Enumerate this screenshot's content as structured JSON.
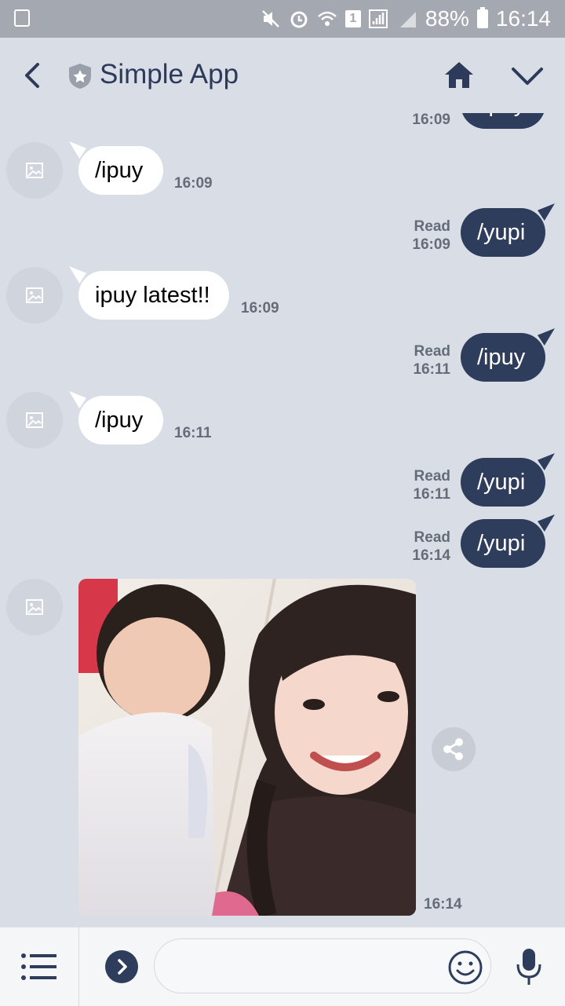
{
  "status_bar": {
    "battery": "88%",
    "time": "16:14",
    "sim_badge": "1"
  },
  "header": {
    "title": "Simple App"
  },
  "messages": [
    {
      "dir": "out",
      "text": "/ipuy",
      "read": "",
      "time": "16:09"
    },
    {
      "dir": "in",
      "text": "/ipuy",
      "time": "16:09"
    },
    {
      "dir": "out",
      "text": "/yupi",
      "read": "Read",
      "time": "16:09"
    },
    {
      "dir": "in",
      "text": "ipuy latest!!",
      "time": "16:09"
    },
    {
      "dir": "out",
      "text": "/ipuy",
      "read": "Read",
      "time": "16:11"
    },
    {
      "dir": "in",
      "text": "/ipuy",
      "time": "16:11"
    },
    {
      "dir": "out",
      "text": "/yupi",
      "read": "Read",
      "time": "16:11"
    },
    {
      "dir": "out",
      "text": "/yupi",
      "read": "Read",
      "time": "16:14"
    },
    {
      "dir": "in",
      "type": "image",
      "time": "16:14"
    }
  ],
  "input": {
    "placeholder": "",
    "value": ""
  },
  "colors": {
    "accent": "#2f3d5c",
    "background": "#d8dde6"
  }
}
